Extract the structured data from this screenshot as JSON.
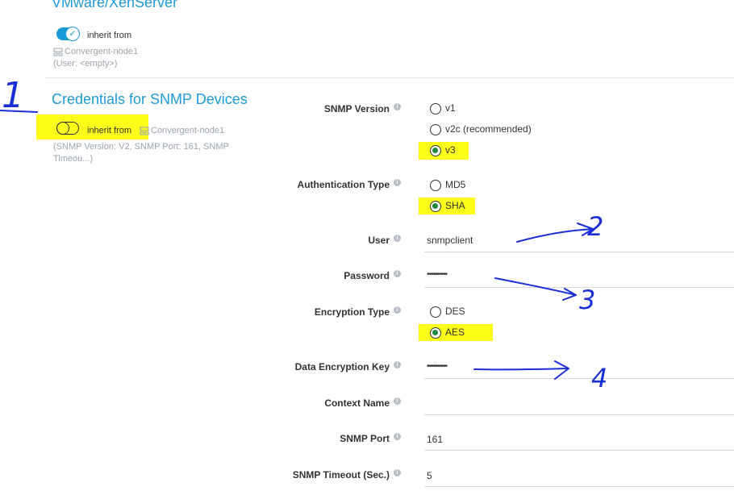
{
  "vmware": {
    "title": "VMware/XenServer",
    "inherit_label": "inherit from",
    "node": "Convergent-node1",
    "summary": "(User: <empty>)"
  },
  "snmp_creds": {
    "title": "Credentials for SNMP Devices",
    "inherit_label": "inherit from",
    "node": "Convergent-node1",
    "summary_line1": "(SNMP Version: V2, SNMP Port: 161, SNMP",
    "summary_line2": "Timeou...)"
  },
  "form": {
    "snmp_version": {
      "label": "SNMP Version",
      "options": [
        "v1",
        "v2c (recommended)",
        "v3"
      ],
      "selected": "v3"
    },
    "auth_type": {
      "label": "Authentication Type",
      "options": [
        "MD5",
        "SHA"
      ],
      "selected": "SHA"
    },
    "user": {
      "label": "User",
      "value": "snmpclient"
    },
    "password": {
      "label": "Password",
      "value": "••••••••••"
    },
    "encryption_type": {
      "label": "Encryption Type",
      "options": [
        "DES",
        "AES"
      ],
      "selected": "AES"
    },
    "data_key": {
      "label": "Data Encryption Key",
      "value": "••••••••••"
    },
    "context_name": {
      "label": "Context Name",
      "value": ""
    },
    "snmp_port": {
      "label": "SNMP Port",
      "value": "161"
    },
    "snmp_timeout": {
      "label": "SNMP Timeout (Sec.)",
      "value": "5"
    }
  },
  "annotations": [
    "1",
    "2",
    "3",
    "4"
  ],
  "colors": {
    "accent": "#1f9ad6",
    "highlight": "#fdff1a",
    "ink": "#1a2fd6",
    "radio_selected": "#1e8a3a"
  }
}
